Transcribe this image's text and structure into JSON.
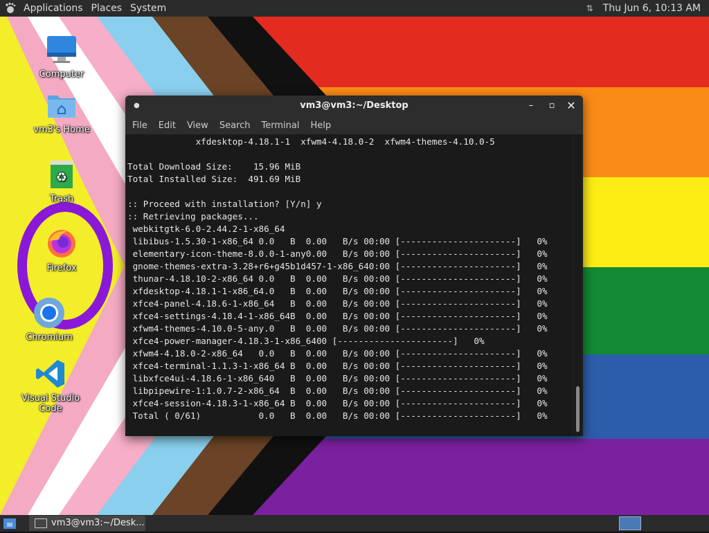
{
  "top_panel": {
    "menus": [
      "Applications",
      "Places",
      "System"
    ],
    "clock": "Thu Jun  6, 10:13 AM"
  },
  "desktop_icons": [
    {
      "label": "Computer",
      "icon": "computer-icon"
    },
    {
      "label": "vm3's Home",
      "icon": "home-folder-icon"
    },
    {
      "label": "Trash",
      "icon": "trash-icon"
    },
    {
      "label": "Firefox",
      "icon": "firefox-icon"
    },
    {
      "label": "Chromium",
      "icon": "chromium-icon"
    },
    {
      "label": "Visual Studio Code",
      "icon": "vscode-icon"
    }
  ],
  "terminal": {
    "title": "vm3@vm3:~/Desktop",
    "menu": [
      "File",
      "Edit",
      "View",
      "Search",
      "Terminal",
      "Help"
    ],
    "lines": [
      "             xfdesktop-4.18.1-1  xfwm4-4.18.0-2  xfwm4-themes-4.10.0-5",
      "",
      "Total Download Size:    15.96 MiB",
      "Total Installed Size:  491.69 MiB",
      "",
      ":: Proceed with installation? [Y/n] y",
      ":: Retrieving packages...",
      " webkitgtk-6.0-2.44.2-1-x86_64",
      " libibus-1.5.30-1-x86_64 0.0   B  0.00   B/s 00:00 [----------------------]   0%",
      " elementary-icon-theme-8.0.0-1-any0.00   B/s 00:00 [----------------------]   0%",
      " gnome-themes-extra-3.28+r6+g45b1d457-1-x86_640:00 [----------------------]   0%",
      " thunar-4.18.10-2-x86_64 0.0   B  0.00   B/s 00:00 [----------------------]   0%",
      " xfdesktop-4.18.1-1-x86_64.0   B  0.00   B/s 00:00 [----------------------]   0%",
      " xfce4-panel-4.18.6-1-x86_64   B  0.00   B/s 00:00 [----------------------]   0%",
      " xfce4-settings-4.18.4-1-x86_64B  0.00   B/s 00:00 [----------------------]   0%",
      " xfwm4-themes-4.10.0-5-any.0   B  0.00   B/s 00:00 [----------------------]   0%",
      " xfce4-power-manager-4.18.3-1-x86_6400 [----------------------]   0%",
      " xfwm4-4.18.0-2-x86_64   0.0   B  0.00   B/s 00:00 [----------------------]   0%",
      " xfce4-terminal-1.1.3-1-x86_64 B  0.00   B/s 00:00 [----------------------]   0%",
      " libxfce4ui-4.18.6-1-x86_640   B  0.00   B/s 00:00 [----------------------]   0%",
      " libpipewire-1:1.0.7-2-x86_64  B  0.00   B/s 00:00 [----------------------]   0%",
      " xfce4-session-4.18.3-1-x86_64 B  0.00   B/s 00:00 [----------------------]   0%",
      " Total ( 0/61)           0.0   B  0.00   B/s 00:00 [----------------------]   0%"
    ]
  },
  "bottom_panel": {
    "task_label": "vm3@vm3:~/Desk..."
  }
}
